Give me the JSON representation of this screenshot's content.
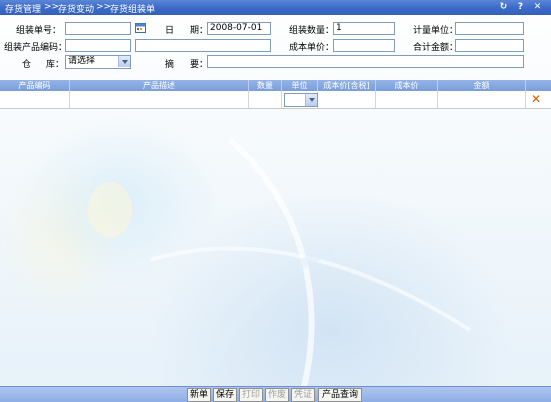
{
  "breadcrumb": {
    "level1": "存货管理",
    "sep1": ">>",
    "level2": "存货变动",
    "sep2": ">>",
    "level3": "存货组装单"
  },
  "titlebar_icons": [
    "refresh-icon",
    "help-icon",
    "close-icon"
  ],
  "titlebar_icon_glyphs": {
    "refresh": "↻",
    "help": "?",
    "close": "✕"
  },
  "form": {
    "assembly_no_label": "组装单号：",
    "assembly_no_value": "",
    "date_label_1": "日",
    "date_label_2": "期：",
    "date_value": "2008-07-01",
    "assembly_qty_label": "组装数量：",
    "assembly_qty_value": "1",
    "unit_label": "计量单位：",
    "unit_value": "",
    "product_code_label": "组装产品编码：",
    "product_code_value": "",
    "product_desc_value": "",
    "cost_price_label": "成本单价：",
    "cost_price_value": "",
    "total_amount_label": "合计金额：",
    "total_amount_value": "",
    "warehouse_label_1": "仓",
    "warehouse_label_2": "库：",
    "warehouse_value": "请选择",
    "summary_label_1": "摘",
    "summary_label_2": "要：",
    "summary_value": ""
  },
  "table": {
    "columns": [
      "产品编码",
      "产品描述",
      "数量",
      "单位",
      "成本价[含税]",
      "成本价",
      "金额"
    ],
    "rows": [
      {
        "code": "",
        "desc": "",
        "qty": "",
        "unit": "",
        "cost_tax": "",
        "cost": "",
        "amount": ""
      }
    ],
    "delete_glyph": "✕"
  },
  "toolbar": {
    "new_label": "新单",
    "save_label": "保存",
    "print_label": "打印",
    "void_label": "作废",
    "voucher_label": "凭证",
    "product_query_label": "产品查询"
  },
  "colors": {
    "titlebar": "#3d6cc8",
    "table_header": "#7b9edb",
    "bottom_bar": "#8eaee6",
    "delete_icon": "#e05a00"
  }
}
